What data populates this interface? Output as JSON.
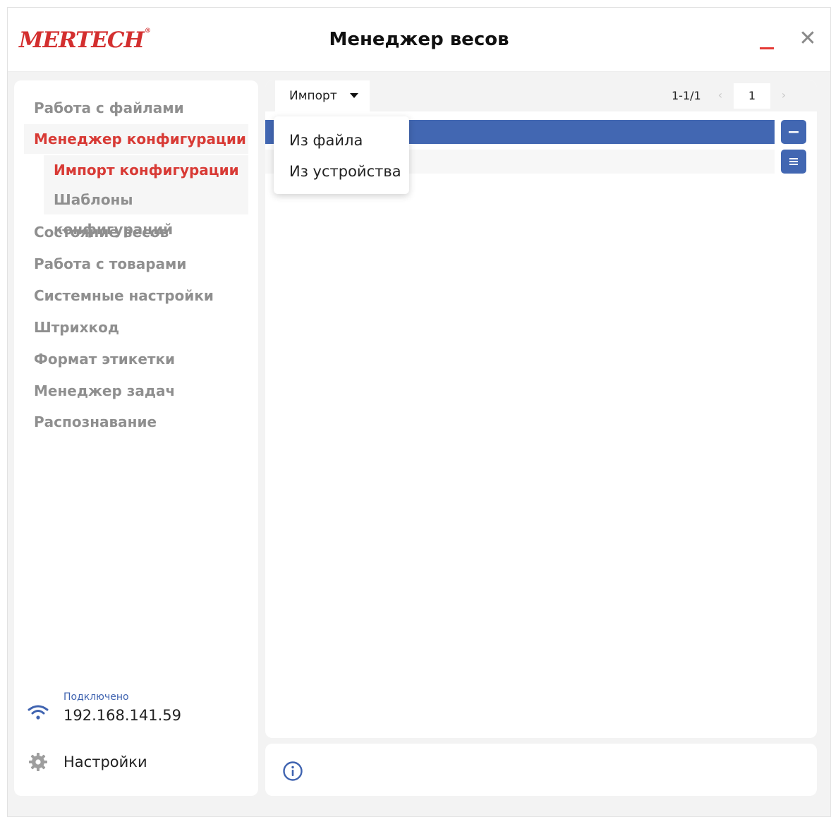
{
  "app": {
    "logo": "MERTECH",
    "logo_mark": "®",
    "title": "Менеджер весов",
    "close_glyph": "✕",
    "accent_color": "#d83a35",
    "primary_color": "#4267b2"
  },
  "sidebar": {
    "items": [
      {
        "label": "Работа с файлами"
      },
      {
        "label": "Менеджер конфигурации",
        "active": true
      },
      {
        "label": "Состояние весов"
      },
      {
        "label": "Работа с товарами"
      },
      {
        "label": "Системные настройки"
      },
      {
        "label": "Штрихкод"
      },
      {
        "label": "Формат этикетки"
      },
      {
        "label": "Менеджер задач"
      },
      {
        "label": "Распознавание"
      }
    ],
    "subitems": [
      {
        "label": "Импорт конфигурации",
        "active": true
      },
      {
        "label": "Шаблоны конфигураций"
      }
    ],
    "connection": {
      "status": "Подключено",
      "ip": "192.168.141.59",
      "icon": "wifi-icon"
    },
    "settings": {
      "label": "Настройки",
      "icon": "gear-icon"
    }
  },
  "toolbar": {
    "import_label": "Импорт",
    "pager": {
      "range": "1-1/1",
      "prev": "‹",
      "page": "1",
      "next": "›"
    }
  },
  "dropdown": {
    "items": [
      {
        "label": "Из файла"
      },
      {
        "label": "Из устройства"
      }
    ]
  },
  "footer": {
    "icon": "info-icon"
  }
}
